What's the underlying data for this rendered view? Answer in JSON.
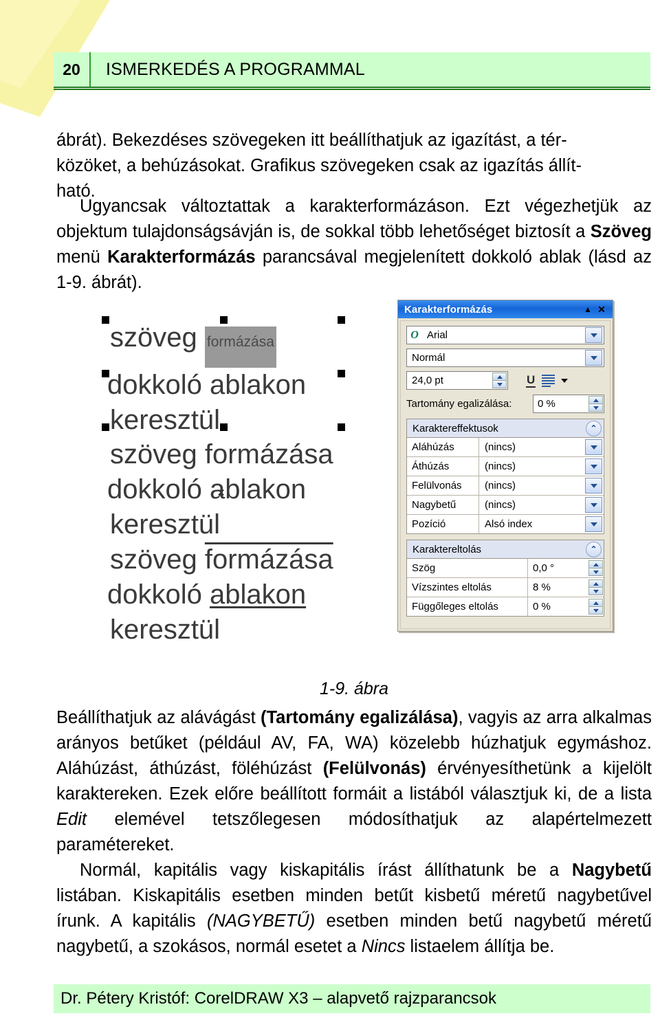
{
  "header": {
    "page_number": "20",
    "chapter_title": "ISMERKEDÉS A PROGRAMMAL",
    "band_color": "#ccffcc",
    "rule_color": "#1f7a1f"
  },
  "body": {
    "paragraph_1_line_1": "ábrát). Bekezdéses szövegeken itt beállíthatjuk az igazítást, a tér-",
    "paragraph_1_line_2": "közöket, a behúzásokat. Grafikus szövegeken csak az igazítás állít-",
    "paragraph_1_line_3": "ható.",
    "paragraph_2_a": "Ugyancsak változtattak a karakterformázáson. Ezt végezhetjük az objektum tulajdonságsávján is, de sokkal több lehetőséget biztosít a ",
    "paragraph_2_bold_1": "Szöveg",
    "paragraph_2_b": " menü ",
    "paragraph_2_bold_2": "Karakterformázás",
    "paragraph_2_c": " parancsával megjelenített dokkoló ablak (lásd az 1-9. ábrát).",
    "paragraph_3_a": "Beállíthatjuk az alávágást ",
    "paragraph_3_bold_1": "(Tartomány egalizálása)",
    "paragraph_3_b": ", vagyis az arra alkalmas arányos betűket (például AV, FA, WA) közelebb húzhatjuk egymáshoz. Aláhúzást, áthúzást, föléhúzást ",
    "paragraph_3_bold_2": "(Felülvonás)",
    "paragraph_3_c": " érvényesíthetünk a kijelölt karaktereken. Ezek előre beállított formáit a listából választjuk ki, de a lista ",
    "paragraph_3_italic_1": "Edit",
    "paragraph_3_d": " elemével tetszőlegesen módosíthatjuk az alapértelmezett paramétereket.",
    "paragraph_4_a": "Normál, kapitális vagy kiskapitális írást állíthatunk be a ",
    "paragraph_4_bold_1": "Nagybetű",
    "paragraph_4_b": " listában. Kiskapitális esetben minden betűt kisbetű méretű nagybetűvel írunk. A kapitális ",
    "paragraph_4_italic_1": "(NAGYBETŰ)",
    "paragraph_4_c": " esetben minden betű nagybetű méretű nagybetű, a szokásos, normál esetet a ",
    "paragraph_4_italic_2": "Nincs",
    "paragraph_4_d": " listaelem állítja be."
  },
  "figure": {
    "caption": "1-9. ábra",
    "sample_art": {
      "block_1": {
        "line_1_normal": "szöveg ",
        "line_1_selected": "formázása",
        "line_2": "dokkoló ablakon",
        "line_3": "keresztül",
        "center_marker": "×"
      },
      "block_2": {
        "line_1": "szöveg formázása",
        "line_2": "dokkoló ablakon",
        "line_3": "keresztül"
      },
      "block_3": {
        "line_1_plain": "szöveg ",
        "line_1_overline": "formázása",
        "line_2_plain": "dokkoló ",
        "line_2_underline": "ablakon",
        "line_3": "keresztül"
      },
      "selection_highlight_color": "#999999",
      "handle_color": "#000000"
    },
    "docker": {
      "title": "Karakterformázás",
      "titlebar_color": "#1565d8",
      "collapse_label": "▲",
      "close_label": "✕",
      "font_name": "Arial",
      "font_icon": "opentype-o-icon",
      "font_style": "Normál",
      "font_size": "24,0 pt",
      "underline_icon_label": "U",
      "range_kerning_label": "Tartomány egalizálása:",
      "range_kerning_value": "0 %",
      "effects_group": {
        "title": "Karaktereffektusok",
        "rows": [
          {
            "label": "Aláhúzás",
            "value": "(nincs)"
          },
          {
            "label": "Áthúzás",
            "value": "(nincs)"
          },
          {
            "label": "Felülvonás",
            "value": "(nincs)"
          },
          {
            "label": "Nagybetű",
            "value": "(nincs)"
          },
          {
            "label": "Pozíció",
            "value": "Alsó index"
          }
        ]
      },
      "shift_group": {
        "title": "Karaktereltolás",
        "rows": [
          {
            "label": "Szög",
            "value": "0,0 °"
          },
          {
            "label": "Vízszintes eltolás",
            "value": "8 %"
          },
          {
            "label": "Függőleges eltolás",
            "value": "0 %"
          }
        ]
      }
    }
  },
  "footer": {
    "text": "Dr. Pétery Kristóf: CorelDRAW X3 – alapvető rajzparancsok",
    "band_color": "#ccffcc"
  }
}
